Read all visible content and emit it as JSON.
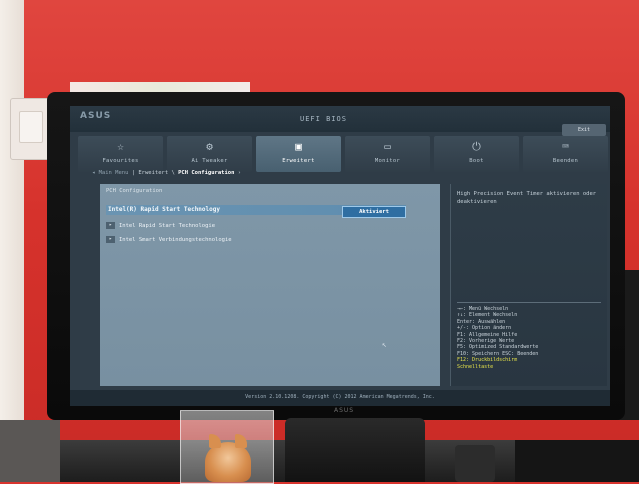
{
  "bios": {
    "brand": "ASUS",
    "title": "UEFI BIOS",
    "exit_button": "Exit",
    "tabs": [
      {
        "label": "Favourites",
        "icon": "star-icon"
      },
      {
        "label": "Ai Tweaker",
        "icon": "tweak-icon"
      },
      {
        "label": "Erweitert",
        "icon": "advanced-icon"
      },
      {
        "label": "Monitor",
        "icon": "monitor-icon"
      },
      {
        "label": "Boot",
        "icon": "power-icon"
      },
      {
        "label": "Beenden",
        "icon": "exit-icon"
      }
    ],
    "active_tab": "Erweitert",
    "breadcrumb": {
      "back": "Main Menu",
      "parent": "Erweitert",
      "current": "PCH Configuration"
    },
    "main": {
      "section_title": "PCH Configuration",
      "selected_setting": {
        "label": "Intel(R) Rapid Start Technology",
        "value": "Aktiviert"
      },
      "submenus": [
        "Intel Rapid Start Technologie",
        "Intel Smart Verbindungstechnologie"
      ]
    },
    "help": {
      "description": "High Precision Event Timer aktivieren oder deaktivieren",
      "keys": [
        {
          "text": "→←: Menü Wechseln",
          "highlight": false
        },
        {
          "text": "↑↓: Element Wechseln",
          "highlight": false
        },
        {
          "text": "Enter: Auswählen",
          "highlight": false
        },
        {
          "text": "+/-: Option ändern",
          "highlight": false
        },
        {
          "text": "F1: Allgemeine Hilfe",
          "highlight": false
        },
        {
          "text": "F2: Vorherige Werte",
          "highlight": false
        },
        {
          "text": "F5: Optimized Standardwerte",
          "highlight": false
        },
        {
          "text": "F10: Speichern  ESC: Beenden",
          "highlight": false
        },
        {
          "text": "F12: Druckbildschirm",
          "highlight": true
        },
        {
          "text": "Schnelltaste",
          "highlight": true
        }
      ]
    },
    "footer": "Version 2.10.1208. Copyright (C) 2012 American Megatrends, Inc.",
    "monitor_logo": "ASUS"
  },
  "colors": {
    "wall": "#d6322c",
    "screen_bg": "#2f3c47",
    "panel": "#7890a1",
    "highlight_row": "#5e8daf",
    "active_tab": "#5f7686",
    "key_highlight": "#e7e34a"
  }
}
